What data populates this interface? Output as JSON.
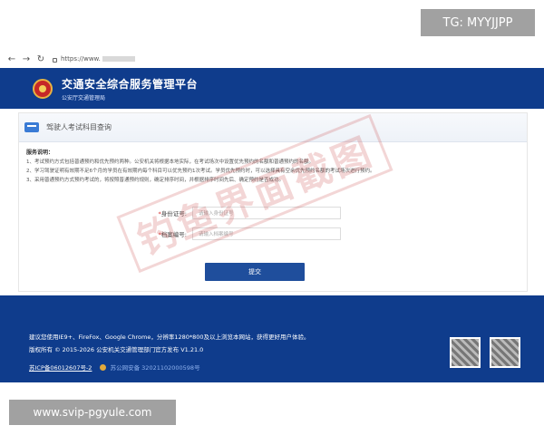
{
  "overlay": {
    "tg": "TG: MYYJJPP",
    "site": "www.svip-pgyule.com"
  },
  "browser": {
    "url_prefix": "https://www."
  },
  "header": {
    "title": "交通安全综合服务管理平台",
    "subtitle": "公安厅交通管理局"
  },
  "section": {
    "title": "驾驶人考试科目查询"
  },
  "notes": {
    "title": "服务说明：",
    "items": [
      "1、考试预约方式包括普通预约和优先预约两种。公安机关将根据本地实际，在考试场次中设置优先预约的名额和普通预约的名额。",
      "2、学习驾驶证明有效期不足6个月的学员在有效期内每个科目可以优先预约1次考试。学员优先预约时，可以选择具有空余优先预约名额的考试场次进行预约。",
      "3、采用普通预约方式预约考试的，将按照普通预约规则，确定排序时间，并根据排序时间先后、确定预约是否成功。"
    ]
  },
  "form": {
    "id_label": "身份证号:",
    "id_placeholder": "请输入身份证号",
    "file_label": "档案编号:",
    "file_placeholder": "请输入档案编号",
    "submit": "提交"
  },
  "watermark": "钓鱼界面截图",
  "footer": {
    "line1": "建议您使用IE9+、FireFox、Google Chrome，分辨率1280*800及以上浏览本网站，获得更好用户体验。",
    "line2": "版权所有 © 2015-2026 公安机关交通管理部门官方发布 V1.21.0",
    "icp": "苏ICP备06012607号-2",
    "psb": "苏公网安备 32021102000598号"
  },
  "colors": {
    "header_bg": "#0f3c8c",
    "button_bg": "#1f4e9c",
    "watermark": "#c84646"
  }
}
